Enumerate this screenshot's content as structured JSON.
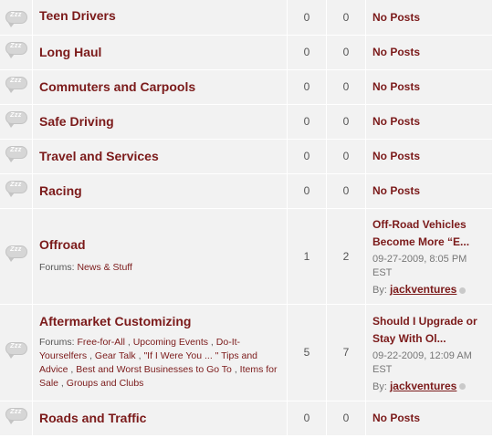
{
  "forums": [
    {
      "title": "Teen Drivers",
      "threads": "0",
      "posts": "0",
      "last_post": "No Posts"
    },
    {
      "title": "Long Haul",
      "threads": "0",
      "posts": "0",
      "last_post": "No Posts"
    },
    {
      "title": "Commuters and Carpools",
      "threads": "0",
      "posts": "0",
      "last_post": "No Posts"
    },
    {
      "title": "Safe Driving",
      "threads": "0",
      "posts": "0",
      "last_post": "No Posts"
    },
    {
      "title": "Travel and Services",
      "threads": "0",
      "posts": "0",
      "last_post": "No Posts"
    },
    {
      "title": "Racing",
      "threads": "0",
      "posts": "0",
      "last_post": "No Posts"
    },
    {
      "title": "Offroad",
      "subforums_label": "Forums:",
      "subforums": [
        "News & Stuff"
      ],
      "threads": "1",
      "posts": "2",
      "last_post": {
        "title": "Off-Road Vehicles Become More “E...",
        "date": "09-27-2009, 8:05 PM EST",
        "by_label": "By:",
        "user": "jackventures"
      }
    },
    {
      "title": "Aftermarket Customizing",
      "subforums_label": "Forums:",
      "subforums": [
        "Free-for-All",
        "Upcoming Events",
        "Do-It-Yourselfers",
        "Gear Talk",
        "\"If I Were You ... \" Tips and Advice",
        "Best and Worst Businesses to Go To",
        "Items for Sale",
        "Groups and Clubs"
      ],
      "threads": "5",
      "posts": "7",
      "last_post": {
        "title": "Should I Upgrade or Stay With Ol...",
        "date": "09-22-2009, 12:09 AM EST",
        "by_label": "By:",
        "user": "jackventures"
      }
    },
    {
      "title": "Roads and Traffic",
      "threads": "0",
      "posts": "0",
      "last_post": "No Posts"
    }
  ],
  "icon_text": "Zzz",
  "colors": {
    "link": "#7b1a1a",
    "row_bg": "#f2f2f2",
    "muted": "#777777"
  }
}
